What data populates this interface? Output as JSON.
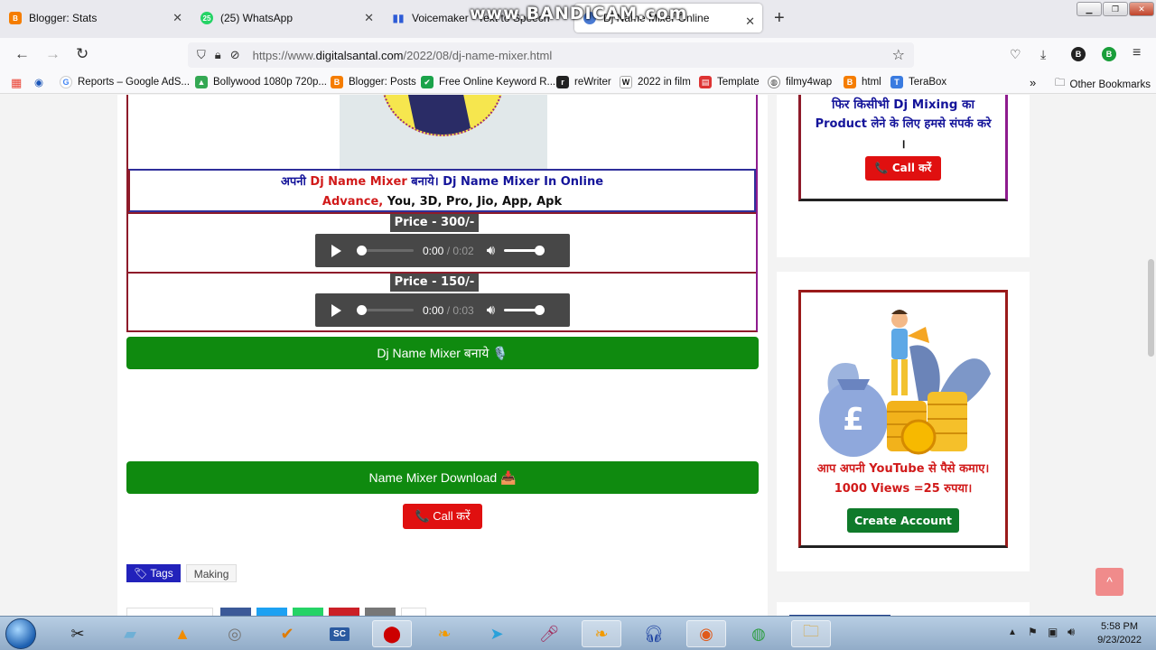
{
  "browser": {
    "tabs": [
      {
        "label": "Blogger: Stats",
        "icon": "blogger-icon",
        "color": "#f57d00"
      },
      {
        "label": "(25) WhatsApp",
        "icon": "whatsapp-icon",
        "color": "#25d366",
        "badge": "25"
      },
      {
        "label": "Voicemaker - Text to Speech",
        "icon": "voicemaker-icon",
        "color": "#2d5bd6"
      },
      {
        "label": "Dj Name Mixer Online",
        "icon": "globe-icon",
        "color": "#4a7bd4"
      }
    ],
    "overlay_watermark": "www.BANDICAM.com",
    "url_prefix": "https://www.",
    "url_domain": "digitalsantal.com",
    "url_path": "/2022/08/dj-name-mixer.html",
    "profile_initial_1": "B",
    "profile_initial_2": "B",
    "bookmarks": [
      {
        "label": "Reports – Google AdS...",
        "icon": "google-icon",
        "color": "#ffffff"
      },
      {
        "label": "Bollywood 1080p 720p...",
        "icon": "drive-icon",
        "color": "#34a853"
      },
      {
        "label": "Blogger: Posts",
        "icon": "blogger-icon",
        "color": "#f57d00"
      },
      {
        "label": "Free Online Keyword R...",
        "icon": "check-icon",
        "color": "#1aa34a"
      },
      {
        "label": "reWriter",
        "icon": "rewriter-icon",
        "color": "#222222"
      },
      {
        "label": "2022 in film",
        "icon": "wikipedia-icon",
        "color": "#ffffff"
      },
      {
        "label": "Template",
        "icon": "template-icon",
        "color": "#d33"
      },
      {
        "label": "filmy4wap",
        "icon": "globe-icon",
        "color": "#ffffff"
      },
      {
        "label": "html",
        "icon": "blogger-icon",
        "color": "#f57d00"
      },
      {
        "label": "TeraBox",
        "icon": "terabox-icon",
        "color": "#3a7be0"
      }
    ],
    "other_bookmarks": "Other Bookmarks"
  },
  "page": {
    "title_line1": {
      "a": "अपनी ",
      "b": "Dj Name Mixer",
      "c": " बनाये। Dj Name Mixer In Online"
    },
    "title_line2": {
      "a": "Advance,",
      "b": " You, 3D, Pro, Jio, App, Apk"
    },
    "prices": [
      {
        "label": "Price - 300/-",
        "time": "0:00",
        "duration": "0:02"
      },
      {
        "label": "Price - 150/-",
        "time": "0:00",
        "duration": "0:03"
      }
    ],
    "make_button": "Dj Name Mixer बनाये 🎙️",
    "download_button": "Name Mixer Download 📥",
    "call_button": "📞 Call करें",
    "tags_label": "Tags",
    "tags": [
      "Making"
    ]
  },
  "sidebar": {
    "card1_line1": "फिर किसीभी Dj Mixing का",
    "card1_line2": "Product लेने के लिए हमसे संपर्क करे",
    "card1_line3": "।",
    "card1_button": "📞 Call करें",
    "card2_text1": "आप अपनी YouTube से पैसे कमाए।",
    "card2_text2": "1000 Views =25 रुपया।",
    "card2_button": "Create Account",
    "pound_symbol": "£"
  },
  "taskbar": {
    "time": "5:58 PM",
    "date": "9/23/2022"
  }
}
